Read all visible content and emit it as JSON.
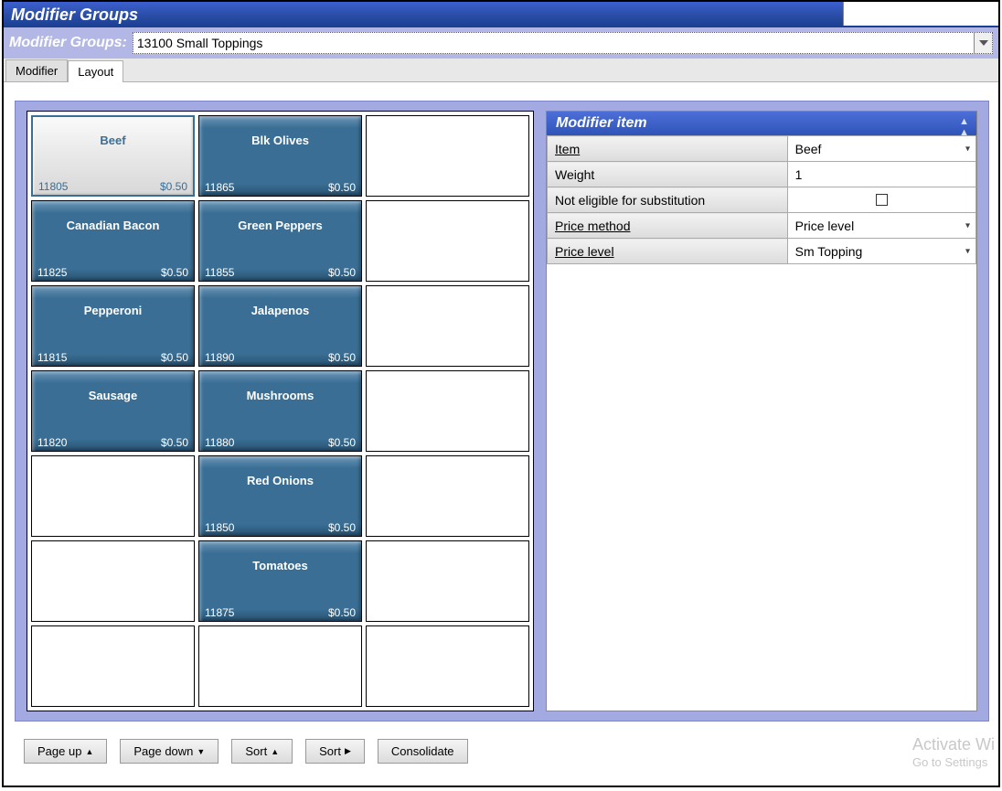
{
  "title": "Modifier Groups",
  "selector": {
    "label": "Modifier Groups:",
    "value": "13100 Small Toppings"
  },
  "tabs": {
    "modifier": "Modifier",
    "layout": "Layout"
  },
  "grid": [
    [
      {
        "name": "Beef",
        "code": "11805",
        "price": "$0.50",
        "state": "selected"
      },
      {
        "name": "Blk Olives",
        "code": "11865",
        "price": "$0.50",
        "state": "filled"
      },
      {
        "name": "",
        "code": "",
        "price": "",
        "state": "empty"
      }
    ],
    [
      {
        "name": "Canadian Bacon",
        "code": "11825",
        "price": "$0.50",
        "state": "filled"
      },
      {
        "name": "Green Peppers",
        "code": "11855",
        "price": "$0.50",
        "state": "filled"
      },
      {
        "name": "",
        "code": "",
        "price": "",
        "state": "empty"
      }
    ],
    [
      {
        "name": "Pepperoni",
        "code": "11815",
        "price": "$0.50",
        "state": "filled"
      },
      {
        "name": "Jalapenos",
        "code": "11890",
        "price": "$0.50",
        "state": "filled"
      },
      {
        "name": "",
        "code": "",
        "price": "",
        "state": "empty"
      }
    ],
    [
      {
        "name": "Sausage",
        "code": "11820",
        "price": "$0.50",
        "state": "filled"
      },
      {
        "name": "Mushrooms",
        "code": "11880",
        "price": "$0.50",
        "state": "filled"
      },
      {
        "name": "",
        "code": "",
        "price": "",
        "state": "empty"
      }
    ],
    [
      {
        "name": "",
        "code": "",
        "price": "",
        "state": "empty"
      },
      {
        "name": "Red Onions",
        "code": "11850",
        "price": "$0.50",
        "state": "filled"
      },
      {
        "name": "",
        "code": "",
        "price": "",
        "state": "empty"
      }
    ],
    [
      {
        "name": "",
        "code": "",
        "price": "",
        "state": "empty"
      },
      {
        "name": "Tomatoes",
        "code": "11875",
        "price": "$0.50",
        "state": "filled"
      },
      {
        "name": "",
        "code": "",
        "price": "",
        "state": "empty"
      }
    ],
    [
      {
        "name": "",
        "code": "",
        "price": "",
        "state": "empty"
      },
      {
        "name": "",
        "code": "",
        "price": "",
        "state": "empty"
      },
      {
        "name": "",
        "code": "",
        "price": "",
        "state": "empty"
      }
    ]
  ],
  "props": {
    "header": "Modifier item",
    "rows": {
      "item_label": "Item",
      "item_value": "Beef",
      "weight_label": "Weight",
      "weight_value": "1",
      "sub_label": "Not eligible for substitution",
      "pmethod_label": "Price method",
      "pmethod_value": "Price level",
      "plevel_label": "Price level",
      "plevel_value": "Sm Topping"
    }
  },
  "buttons": {
    "pageup": "Page up",
    "pagedown": "Page down",
    "sort1": "Sort",
    "sort2": "Sort",
    "consolidate": "Consolidate"
  },
  "watermark": {
    "line1": "Activate Wi",
    "line2": "Go to Settings"
  }
}
